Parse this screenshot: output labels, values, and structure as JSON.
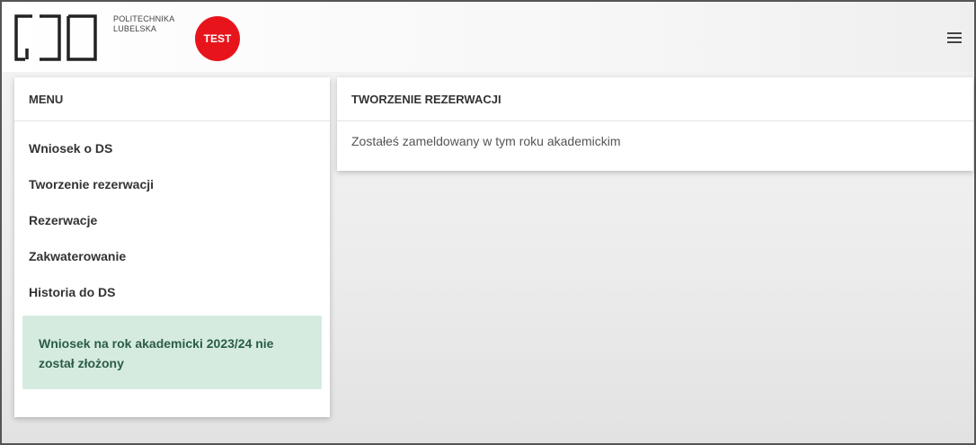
{
  "header": {
    "logo_line1": "POLITECHNIKA",
    "logo_line2": "LUBELSKA",
    "badge": "TEST"
  },
  "menu": {
    "title": "MENU",
    "items": [
      {
        "label": "Wniosek o DS"
      },
      {
        "label": "Tworzenie rezerwacji"
      },
      {
        "label": "Rezerwacje"
      },
      {
        "label": "Zakwaterowanie"
      },
      {
        "label": "Historia do DS"
      }
    ],
    "alert": "Wniosek na rok akademicki 2023/24 nie został złożony"
  },
  "main": {
    "title": "TWORZENIE REZERWACJI",
    "message": "Zostałeś zameldowany w tym roku akademickim"
  },
  "colors": {
    "badge": "#e8141c",
    "alert_bg": "#d6ebe0",
    "alert_text": "#2a5d45"
  },
  "icons": {
    "menu": "hamburger-icon",
    "logo": "politechnika-logo"
  }
}
